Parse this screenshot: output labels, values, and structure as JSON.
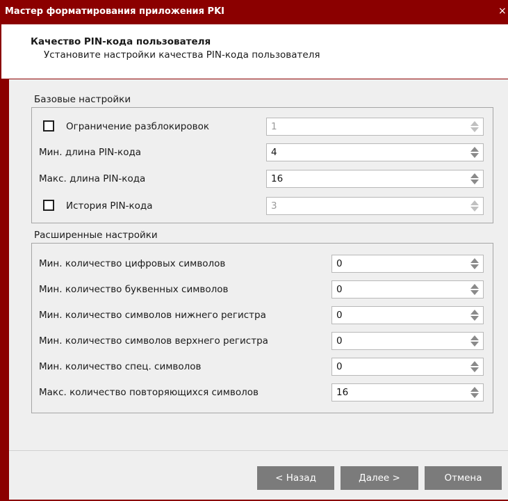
{
  "window": {
    "title": "Мастер форматирования приложения PKI",
    "close_glyph": "×"
  },
  "header": {
    "title": "Качество PIN-кода пользователя",
    "subtitle": "Установите настройки качества PIN-кода пользователя"
  },
  "basic": {
    "label": "Базовые настройки",
    "unlock_limit": {
      "label": "Ограничение разблокировок",
      "checked": false,
      "value": "1",
      "enabled": false
    },
    "min_length": {
      "label": "Мин. длина PIN-кода",
      "value": "4"
    },
    "max_length": {
      "label": "Макс. длина PIN-кода",
      "value": "16"
    },
    "history": {
      "label": "История PIN-кода",
      "checked": false,
      "value": "3",
      "enabled": false
    }
  },
  "advanced": {
    "label": "Расширенные настройки",
    "rows": [
      {
        "label": "Мин. количество цифровых символов",
        "value": "0"
      },
      {
        "label": "Мин. количество буквенных символов",
        "value": "0"
      },
      {
        "label": "Мин. количество символов нижнего регистра",
        "value": "0"
      },
      {
        "label": "Мин. количество символов верхнего регистра",
        "value": "0"
      },
      {
        "label": "Мин. количество спец. символов",
        "value": "0"
      },
      {
        "label": "Макс. количество повторяющихся символов",
        "value": "16"
      }
    ]
  },
  "buttons": {
    "back": "< Назад",
    "next": "Далее >",
    "cancel": "Отмена"
  },
  "colors": {
    "titlebar": "#8b0000",
    "button": "#7b7b7b",
    "panel": "#efefef"
  }
}
